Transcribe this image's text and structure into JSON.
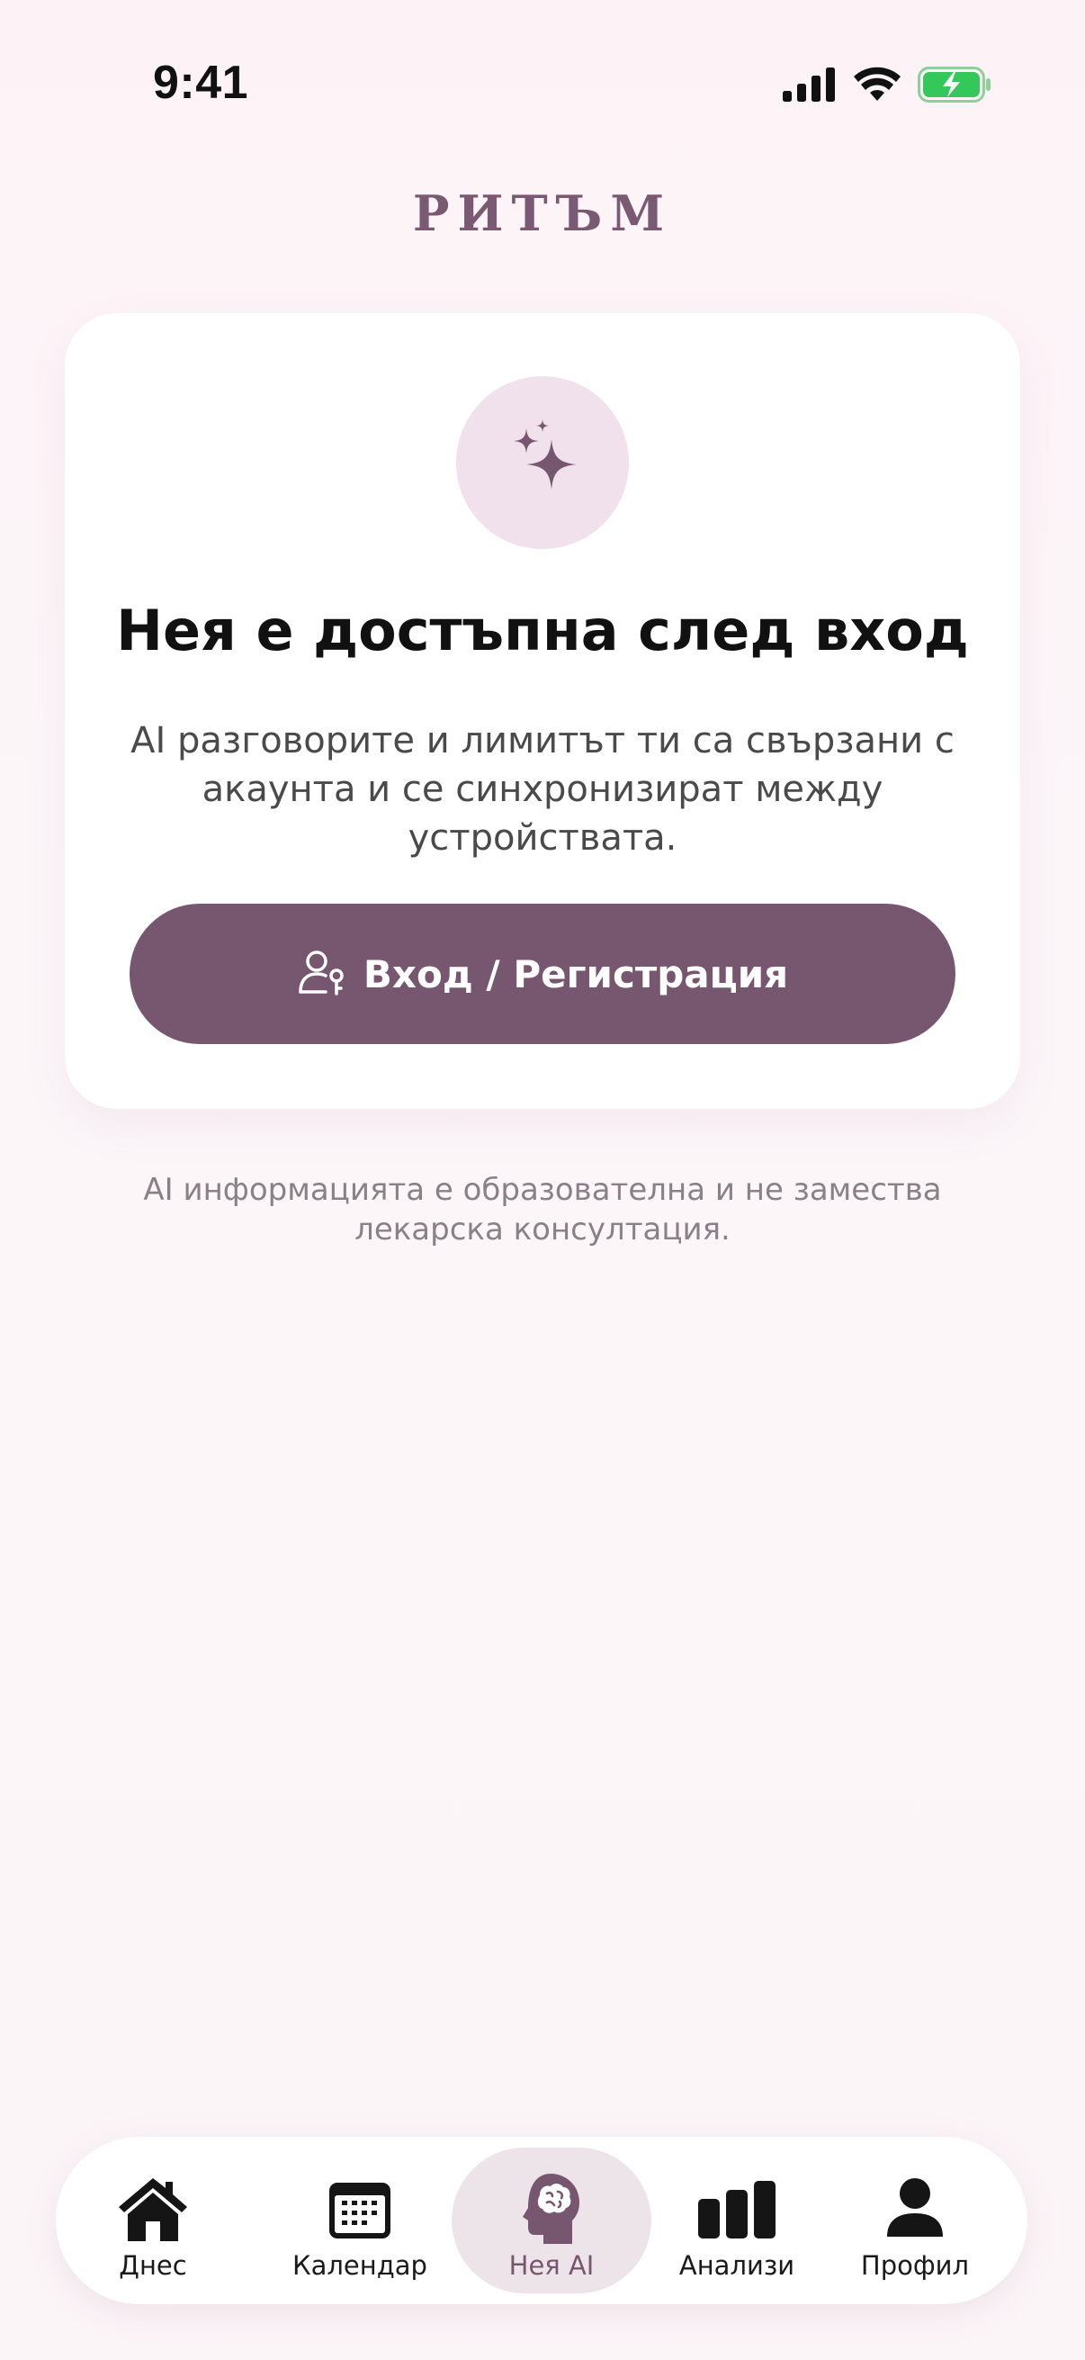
{
  "status_bar": {
    "time": "9:41",
    "icons": [
      "cellular-signal-icon",
      "wifi-icon",
      "battery-charging-icon"
    ]
  },
  "brand": {
    "name": "РИТЪМ"
  },
  "card": {
    "icon": "sparkles-icon",
    "title": "Нея е достъпна след вход",
    "description": "AI разговорите и лимитът ти са свързани с акаунта и се синхронизират между устройствата.",
    "button_label": "Вход / Регистрация",
    "button_icon": "user-key-icon"
  },
  "disclaimer": "AI информацията е образователна и не замества лекарска консултация.",
  "tab_bar": {
    "tabs": [
      {
        "label": "Днес",
        "icon": "home-icon"
      },
      {
        "label": "Календар",
        "icon": "calendar-icon"
      },
      {
        "label": "Нея AI",
        "icon": "brain-head-icon",
        "active": true
      },
      {
        "label": "Анализи",
        "icon": "bar-chart-icon"
      },
      {
        "label": "Профил",
        "icon": "person-icon"
      }
    ]
  },
  "colors": {
    "accent": "#77566F",
    "accent_light": "#F1E1EC",
    "background": "#FCF5F8",
    "battery_green": "#34C759"
  }
}
